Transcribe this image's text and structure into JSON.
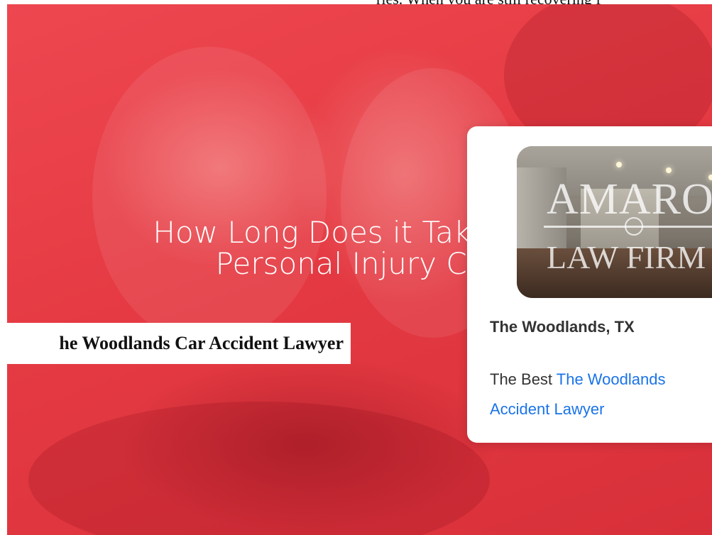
{
  "top_text": "ries.  When you are still recovering f",
  "hero": {
    "title_line1": "How Long Does it Take",
    "title_line2": "Personal Injury Cl"
  },
  "caption": {
    "text": "he Woodlands Car Accident Lawyer"
  },
  "card": {
    "image_logo_name": "AMARO",
    "image_logo_sub": "LAW FIRM",
    "location": "The Woodlands, TX",
    "desc_prefix": "The Best ",
    "desc_link_part1": "The Woodlands",
    "desc_link_part2": "Accident Lawyer"
  },
  "colors": {
    "hero_red": "#e53a43",
    "link_blue": "#1a73e8",
    "text_dark": "#333333"
  }
}
